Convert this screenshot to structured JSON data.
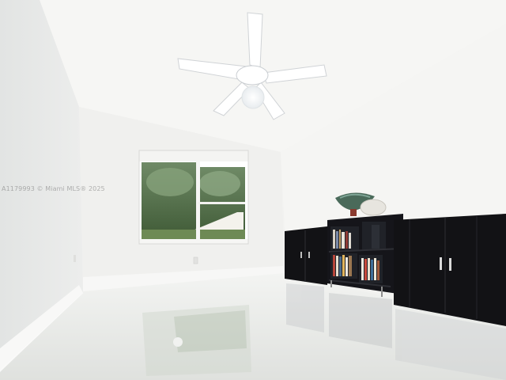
{
  "photo": {
    "watermark": "A1179993 © Miami MLS® 2025"
  },
  "colors": {
    "ceiling": "#f6f6f4",
    "left_wall": "#ebeceb",
    "back_wall": "#f1f1ef",
    "right_wall": "#f4f4f2",
    "floor": "#e7e8e6",
    "cabinet": "#141416",
    "fan": "#ffffff"
  }
}
